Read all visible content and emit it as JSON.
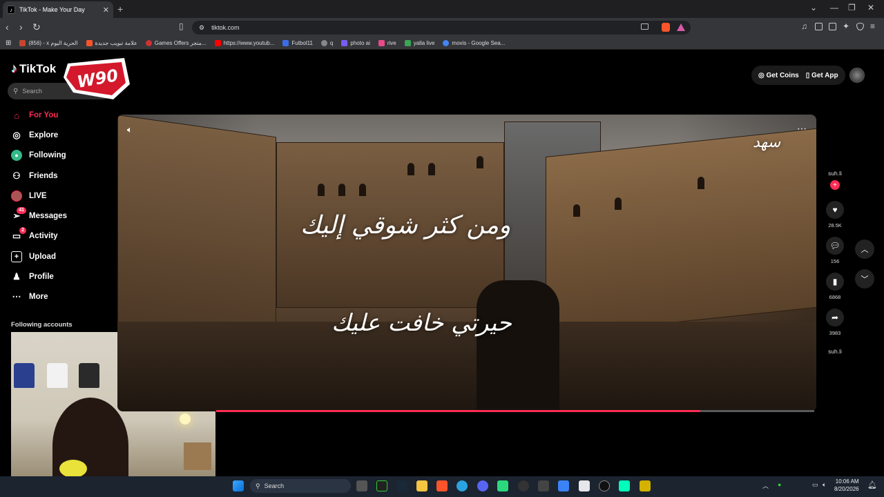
{
  "browser": {
    "tab_title": "TikTok - Make Your Day",
    "url": "tiktok.com",
    "bookmarks": [
      {
        "label": "(856) - x الحرية اليوم",
        "color": "#c6452f"
      },
      {
        "label": "علامة تبويب جديدة",
        "color": "#fb542b"
      },
      {
        "label": "Games Offers متجر...",
        "color": "#c33"
      },
      {
        "label": "https://www.youtub...",
        "color": "#f00"
      },
      {
        "label": "Futbol11",
        "color": "#3a6ee8"
      },
      {
        "label": "q",
        "color": "#888"
      },
      {
        "label": "photo ai",
        "color": "#7a5cf0"
      },
      {
        "label": "rive",
        "color": "#e84a8a"
      },
      {
        "label": "yalla live",
        "color": "#3aa655"
      },
      {
        "label": "movis - Google Sea...",
        "color": "#4285f4"
      }
    ]
  },
  "tiktok": {
    "logo": "TikTok",
    "search_placeholder": "Search",
    "nav": [
      {
        "label": "For You",
        "icon": "home-icon"
      },
      {
        "label": "Explore",
        "icon": "compass-icon"
      },
      {
        "label": "Following",
        "icon": "following-icon"
      },
      {
        "label": "Friends",
        "icon": "friends-icon"
      },
      {
        "label": "LIVE",
        "icon": "live-icon"
      },
      {
        "label": "Messages",
        "icon": "messages-icon",
        "badge": "41"
      },
      {
        "label": "Activity",
        "icon": "activity-icon",
        "badge": "2"
      },
      {
        "label": "Upload",
        "icon": "upload-icon"
      },
      {
        "label": "Profile",
        "icon": "profile-icon"
      },
      {
        "label": "More",
        "icon": "more-icon"
      }
    ],
    "following_accounts": "Following accounts",
    "get_coins": "Get Coins",
    "get_app": "Get App",
    "overlay_logo": "W90",
    "video": {
      "caption_line1": "ومن كثر شوقي إليك",
      "caption_line2": "حيرتي خافت عليك",
      "corner_text": "سهد",
      "progress": 0.81
    },
    "actions": {
      "author": "suh.li",
      "likes": "28.5K",
      "comments": "156",
      "saves": "6868",
      "shares": "3983",
      "sound_author": "suh.li"
    }
  },
  "taskbar": {
    "search": "Search",
    "time": "10:06 AM",
    "date": "8/20/2026"
  },
  "colors": {
    "accent": "#fe2c55"
  }
}
